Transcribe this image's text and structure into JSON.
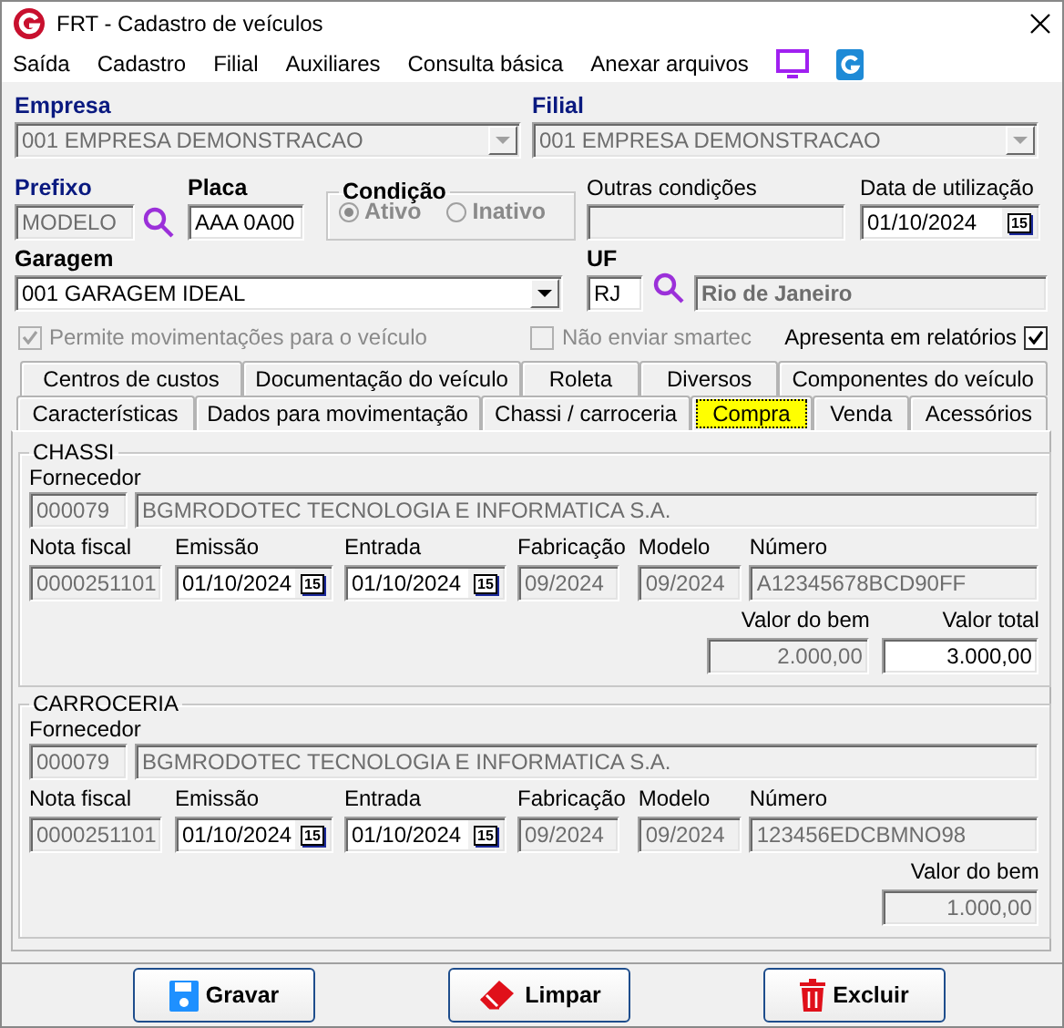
{
  "window": {
    "title": "FRT - Cadastro de veículos"
  },
  "menu": [
    "Saída",
    "Cadastro",
    "Filial",
    "Auxiliares",
    "Consulta básica",
    "Anexar arquivos"
  ],
  "empresa": {
    "label": "Empresa",
    "highlighted": true,
    "value": "001 EMPRESA DEMONSTRACAO",
    "disabled": true
  },
  "filial": {
    "label": "Filial",
    "highlighted": true,
    "value": "001 EMPRESA DEMONSTRACAO",
    "disabled": true
  },
  "prefixo": {
    "label": "Prefixo",
    "highlighted": true,
    "value": "MODELO",
    "disabled": true
  },
  "placa": {
    "label": "Placa",
    "highlighted": false,
    "value": "AAA 0A00",
    "disabled": false
  },
  "condicao": {
    "label": "Condição",
    "disabled": true,
    "options": [
      {
        "label": "Ativo",
        "selected": true
      },
      {
        "label": "Inativo",
        "selected": false
      }
    ]
  },
  "outras_condicoes": {
    "label": "Outras condições",
    "disabled": true
  },
  "data_utilizacao": {
    "label": "Data de utilização",
    "value": "01/10/2024",
    "button": "15",
    "disabled": false
  },
  "garagem": {
    "label": "Garagem",
    "highlighted": false,
    "value": "001 GARAGEM IDEAL",
    "disabled": false
  },
  "uf": {
    "label": "UF",
    "highlighted": false,
    "value": "RJ",
    "disabled": false
  },
  "uf_nome": {
    "value": "Rio de Janeiro",
    "disabled": true
  },
  "options": [
    {
      "label": "Permite movimentações para o veículo",
      "checked": true,
      "disabled": true
    },
    {
      "label": "Não enviar smartec",
      "checked": false,
      "disabled": true
    },
    {
      "label": "Apresenta em relatórios",
      "checked": true,
      "disabled": false
    }
  ],
  "tab_rows": [
    [
      {
        "label": "Centros de custos",
        "selected": false
      },
      {
        "label": "Documentação do veículo",
        "selected": false
      },
      {
        "label": "Roleta",
        "selected": false
      },
      {
        "label": "Diversos",
        "selected": false
      },
      {
        "label": "Componentes do veículo",
        "selected": false
      }
    ],
    [
      {
        "label": "Características",
        "selected": false
      },
      {
        "label": "Dados para movimentação",
        "selected": false
      },
      {
        "label": "Chassi / carroceria",
        "selected": false
      },
      {
        "label": "Compra",
        "selected": true
      },
      {
        "label": "Venda",
        "selected": false
      },
      {
        "label": "Acessórios",
        "selected": false
      }
    ]
  ],
  "sections": [
    {
      "title": "CHASSI",
      "fornecedor": {
        "label": "Fornecedor",
        "code": "000079",
        "name": "BGMRODOTEC TECNOLOGIA E INFORMATICA S.A.",
        "disabled": true
      },
      "fields": [
        {
          "label": "Nota fiscal",
          "value": "0000251101",
          "disabled": true
        },
        {
          "label": "Emissão",
          "value": "01/10/2024",
          "button": "15",
          "disabled": false
        },
        {
          "label": "Entrada",
          "value": "01/10/2024",
          "button": "15",
          "disabled": false
        },
        {
          "label": "Fabricação",
          "value": "09/2024",
          "disabled": true
        },
        {
          "label": "Modelo",
          "value": "09/2024",
          "disabled": true
        },
        {
          "label": "Número",
          "value": "A12345678BCD90FF",
          "disabled": true
        }
      ],
      "values": [
        {
          "label": "Valor do bem",
          "value": "2.000,00",
          "disabled": true
        },
        {
          "label": "Valor total",
          "value": "3.000,00",
          "disabled": false
        }
      ]
    },
    {
      "title": "CARROCERIA",
      "fornecedor": {
        "label": "Fornecedor",
        "code": "000079",
        "name": "BGMRODOTEC TECNOLOGIA E INFORMATICA S.A.",
        "disabled": true
      },
      "fields": [
        {
          "label": "Nota fiscal",
          "value": "0000251101",
          "disabled": true
        },
        {
          "label": "Emissão",
          "value": "01/10/2024",
          "button": "15",
          "disabled": false
        },
        {
          "label": "Entrada",
          "value": "01/10/2024",
          "button": "15",
          "disabled": false
        },
        {
          "label": "Fabricação",
          "value": "09/2024",
          "disabled": true
        },
        {
          "label": "Modelo",
          "value": "09/2024",
          "disabled": true
        },
        {
          "label": "Número",
          "value": "123456EDCBMNO98",
          "disabled": true
        }
      ],
      "values": [
        {
          "label": "Valor do bem",
          "value": "1.000,00",
          "disabled": true
        }
      ]
    }
  ],
  "buttons": [
    {
      "label": "Gravar",
      "kind": "save"
    },
    {
      "label": "Limpar",
      "kind": "clear"
    },
    {
      "label": "Excluir",
      "kind": "delete"
    }
  ]
}
